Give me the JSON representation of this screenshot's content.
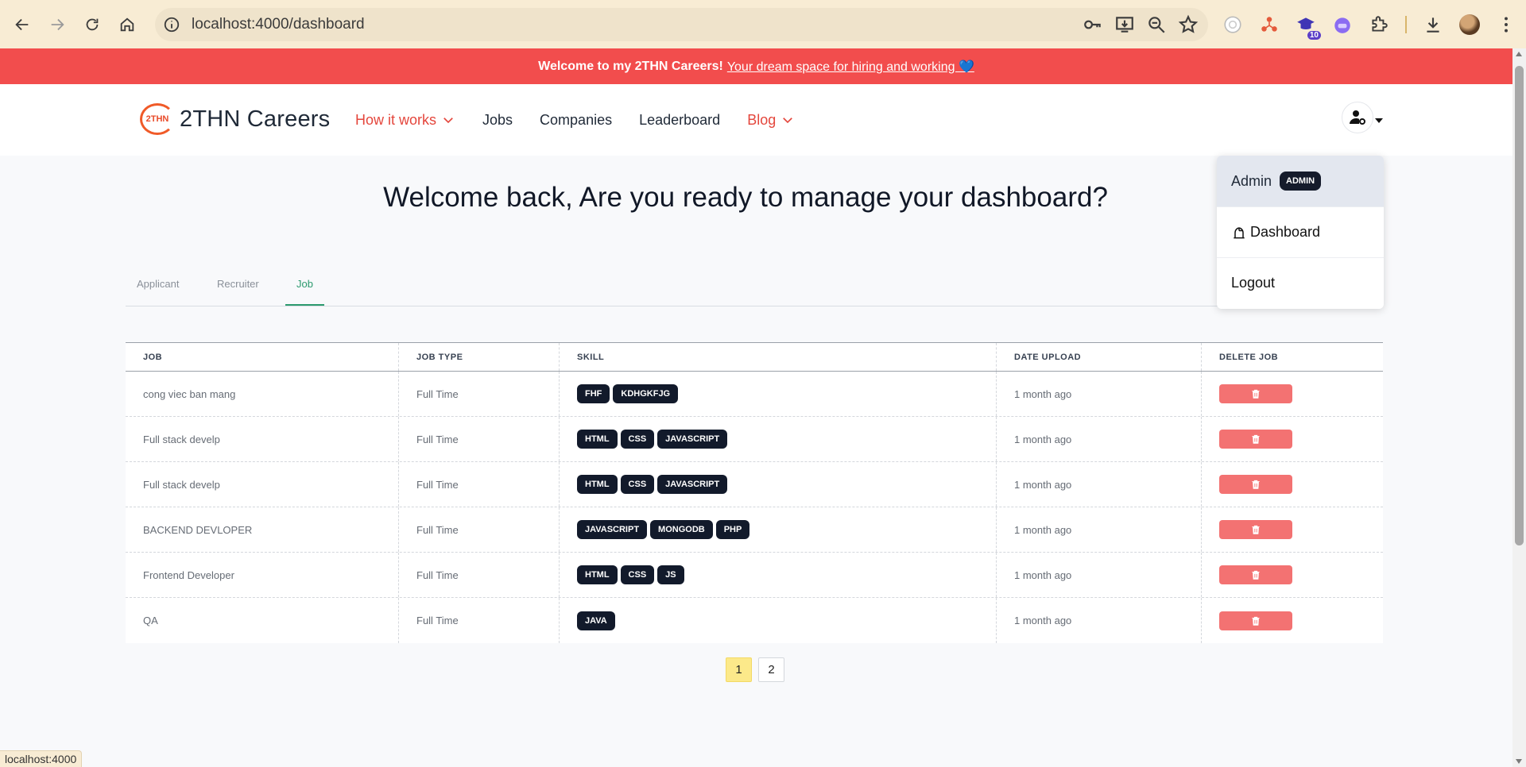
{
  "browser": {
    "url": "localhost:4000/dashboard",
    "extension_badge": "10",
    "status_text": "localhost:4000"
  },
  "announcement": {
    "bold_text": "Welcome to my 2THN Careers!",
    "link_text": "Your dream space for hiring and working 💙"
  },
  "site": {
    "logo_mark": "2THN",
    "logo_text": "2THN Careers",
    "menu": {
      "how_it_works": "How it works",
      "jobs": "Jobs",
      "companies": "Companies",
      "leaderboard": "Leaderboard",
      "blog": "Blog"
    }
  },
  "user_dropdown": {
    "name": "Admin",
    "role_badge": "ADMIN",
    "dashboard": "Dashboard",
    "logout": "Logout"
  },
  "heading": "Welcome back, Are you ready to manage your dashboard?",
  "tabs": [
    "Applicant",
    "Recruiter",
    "Job"
  ],
  "active_tab": "Job",
  "table": {
    "headers": [
      "JOB",
      "JOB TYPE",
      "SKILL",
      "DATE UPLOAD",
      "DELETE JOB"
    ],
    "rows": [
      {
        "job": "cong viec ban mang",
        "type": "Full Time",
        "skills": [
          "FHF",
          "KDHGKFJG"
        ],
        "date": "1 month ago"
      },
      {
        "job": "Full stack develp",
        "type": "Full Time",
        "skills": [
          "HTML",
          "CSS",
          "JAVASCRIPT"
        ],
        "date": "1 month ago"
      },
      {
        "job": "Full stack develp",
        "type": "Full Time",
        "skills": [
          "HTML",
          "CSS",
          "JAVASCRIPT"
        ],
        "date": "1 month ago"
      },
      {
        "job": "BACKEND DEVLOPER",
        "type": "Full Time",
        "skills": [
          "JAVASCRIPT",
          "MONGODB",
          "PHP"
        ],
        "date": "1 month ago"
      },
      {
        "job": "Frontend Developer",
        "type": "Full Time",
        "skills": [
          "HTML",
          "CSS",
          "JS"
        ],
        "date": "1 month ago"
      },
      {
        "job": "QA",
        "type": "Full Time",
        "skills": [
          "JAVA"
        ],
        "date": "1 month ago"
      }
    ]
  },
  "pagination": {
    "pages": [
      "1",
      "2"
    ],
    "current": "1"
  },
  "colors": {
    "announcement_bg": "#f24d4d",
    "accent_red": "#e4463c",
    "active_tab": "#2c9a6e",
    "skill_badge": "#121a2b",
    "delete_button": "#f37272",
    "active_page": "#fce98a"
  }
}
